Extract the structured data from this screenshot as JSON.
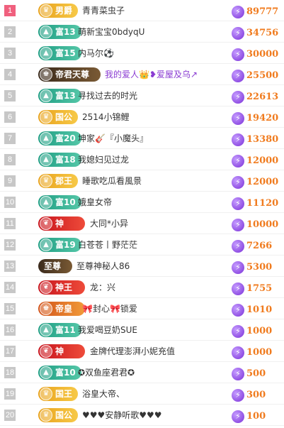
{
  "colors": {
    "score": "#f07b1e",
    "gem": "#8a3bd2",
    "top_rank": "#f0607e",
    "rank": "#c7c7c7"
  },
  "rows": [
    {
      "rank": "1",
      "badge": "男爵",
      "badge_style": "gold",
      "badge_icon": "crown",
      "name": "青青菜虫子",
      "score": "89777"
    },
    {
      "rank": "2",
      "badge": "富13",
      "badge_style": "teal",
      "badge_icon": "triangle",
      "name": "萌新宝宝0bdyqU",
      "score": "34756"
    },
    {
      "rank": "3",
      "badge": "富15",
      "badge_style": "teal",
      "badge_icon": "triangle",
      "name": "内马尔⚽",
      "score": "30000"
    },
    {
      "rank": "4",
      "badge": "帝君天尊",
      "badge_style": "dark",
      "badge_icon": "crest",
      "name": "我的爱人👑❥爱屋及乌↗",
      "score": "25500",
      "name_style": "purple"
    },
    {
      "rank": "5",
      "badge": "富13",
      "badge_style": "teal",
      "badge_icon": "triangle",
      "name": "寻找过去的时光",
      "score": "22613"
    },
    {
      "rank": "6",
      "badge": "国公",
      "badge_style": "gold",
      "badge_icon": "crown",
      "name": "2514小锦鲤",
      "score": "19420"
    },
    {
      "rank": "7",
      "badge": "富20",
      "badge_style": "teal",
      "badge_icon": "triangle",
      "name": "坤家🎸『小魔头』",
      "score": "13380"
    },
    {
      "rank": "8",
      "badge": "富18",
      "badge_style": "teal",
      "badge_icon": "triangle",
      "name": "我媳妇见过龙",
      "score": "12000"
    },
    {
      "rank": "9",
      "badge": "郡王",
      "badge_style": "gold",
      "badge_icon": "crown",
      "name": "睡歌吃瓜看風景",
      "score": "12000"
    },
    {
      "rank": "10",
      "badge": "富10",
      "badge_style": "teal",
      "badge_icon": "triangle",
      "name": "娥皇女帝",
      "score": "11120"
    },
    {
      "rank": "11",
      "badge": "神",
      "badge_style": "red",
      "badge_icon": "wing",
      "name": "大同*小异",
      "score": "10000"
    },
    {
      "rank": "12",
      "badge": "富19",
      "badge_style": "teal",
      "badge_icon": "triangle",
      "name": "白苍苍丨野茫茫",
      "score": "7266"
    },
    {
      "rank": "13",
      "badge": "至尊",
      "badge_style": "dark",
      "badge_icon": "none",
      "name": "至尊神秘人86",
      "score": "5300"
    },
    {
      "rank": "14",
      "badge": "神王",
      "badge_style": "red",
      "badge_icon": "wing",
      "name": "龙：兴",
      "score": "1755"
    },
    {
      "rank": "15",
      "badge": "帝皇",
      "badge_style": "orange",
      "badge_icon": "crest",
      "name": "🎀封心🎀锁爱",
      "score": "1010"
    },
    {
      "rank": "16",
      "badge": "富11",
      "badge_style": "teal",
      "badge_icon": "triangle",
      "name": "我爱喝豆奶SUE",
      "score": "1000"
    },
    {
      "rank": "17",
      "badge": "神",
      "badge_style": "red",
      "badge_icon": "wing",
      "name": "金牌代理澎湃小妮充值",
      "score": "1000"
    },
    {
      "rank": "18",
      "badge": "富10",
      "badge_style": "teal",
      "badge_icon": "triangle",
      "name": "✪双鱼座君君✪",
      "score": "500"
    },
    {
      "rank": "19",
      "badge": "国王",
      "badge_style": "gold",
      "badge_icon": "crown",
      "name": "浴皇大帝、",
      "score": "300"
    },
    {
      "rank": "20",
      "badge": "国公",
      "badge_style": "gold",
      "badge_icon": "crown",
      "name": "♥♥♥安静听歌♥♥♥",
      "score": "100"
    }
  ]
}
